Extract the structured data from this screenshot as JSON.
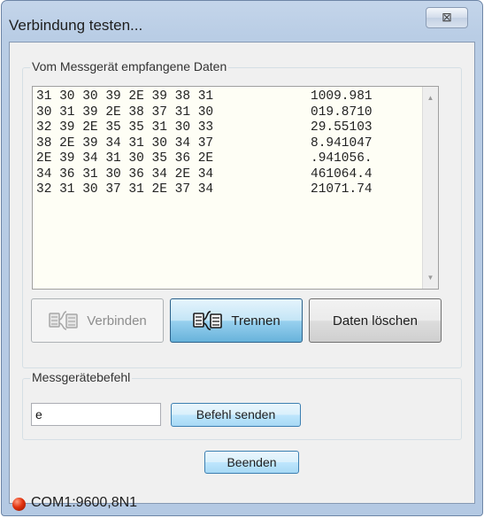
{
  "window": {
    "title": "Verbindung testen...",
    "close_glyph": "⊠"
  },
  "data_group": {
    "label": "Vom Messgerät empfangene Daten",
    "rows": [
      {
        "hex": "31 30 30 39 2E 39 38 31",
        "ascii": "1009.981"
      },
      {
        "hex": "30 31 39 2E 38 37 31 30",
        "ascii": "019.8710"
      },
      {
        "hex": "32 39 2E 35 35 31 30 33",
        "ascii": "29.55103"
      },
      {
        "hex": "38 2E 39 34 31 30 34 37",
        "ascii": "8.941047"
      },
      {
        "hex": "2E 39 34 31 30 35 36 2E",
        "ascii": ".941056."
      },
      {
        "hex": "34 36 31 30 36 34 2E 34",
        "ascii": "461064.4"
      },
      {
        "hex": "32 31 30 37 31 2E 37 34",
        "ascii": "21071.74"
      }
    ]
  },
  "buttons": {
    "connect": "Verbinden",
    "disconnect": "Trennen",
    "clear": "Daten löschen",
    "send": "Befehl senden",
    "exit": "Beenden"
  },
  "command_group": {
    "label": "Messgerätebefehl",
    "input_value": "e"
  },
  "status": {
    "text": "COM1:9600,8N1",
    "led_color": "#e2330f"
  },
  "icons": {
    "connect": "plug-connect-icon",
    "disconnect": "plug-disconnect-icon"
  }
}
